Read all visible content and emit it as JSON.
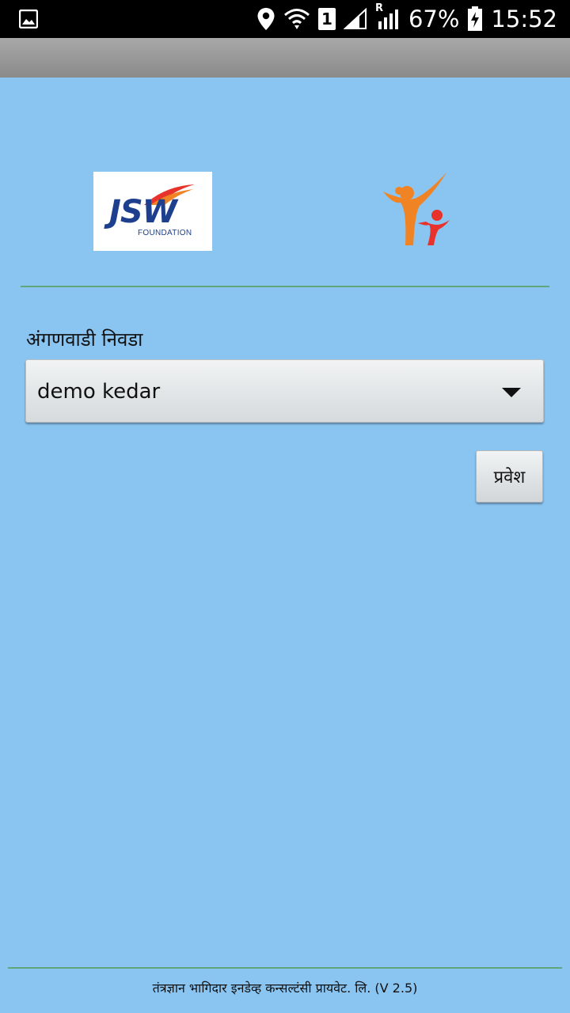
{
  "status_bar": {
    "battery": "67%",
    "time": "15:52",
    "sim_slot": "1",
    "roaming": "R",
    "icons": [
      "gallery-icon",
      "location-icon",
      "wifi-icon",
      "sim-1-icon",
      "signal-icon",
      "signal-roaming-icon",
      "battery-charging-icon"
    ]
  },
  "logos": {
    "jsw_word": "JSW",
    "jsw_sub": "FOUNDATION"
  },
  "form": {
    "label": "अंगणवाडी निवडा",
    "selected_value": "demo kedar",
    "submit_label": "प्रवेश"
  },
  "footer": {
    "text": "तंत्रज्ञान भागिदार इनडेव्ह कन्सल्टंसी प्रायवेट. लि. (V 2.5)"
  },
  "colors": {
    "background": "#8ac5f1",
    "divider": "#5fa77a",
    "jsw_blue": "#1d3f8e",
    "logo_orange": "#f08424",
    "logo_red": "#e8332c"
  }
}
